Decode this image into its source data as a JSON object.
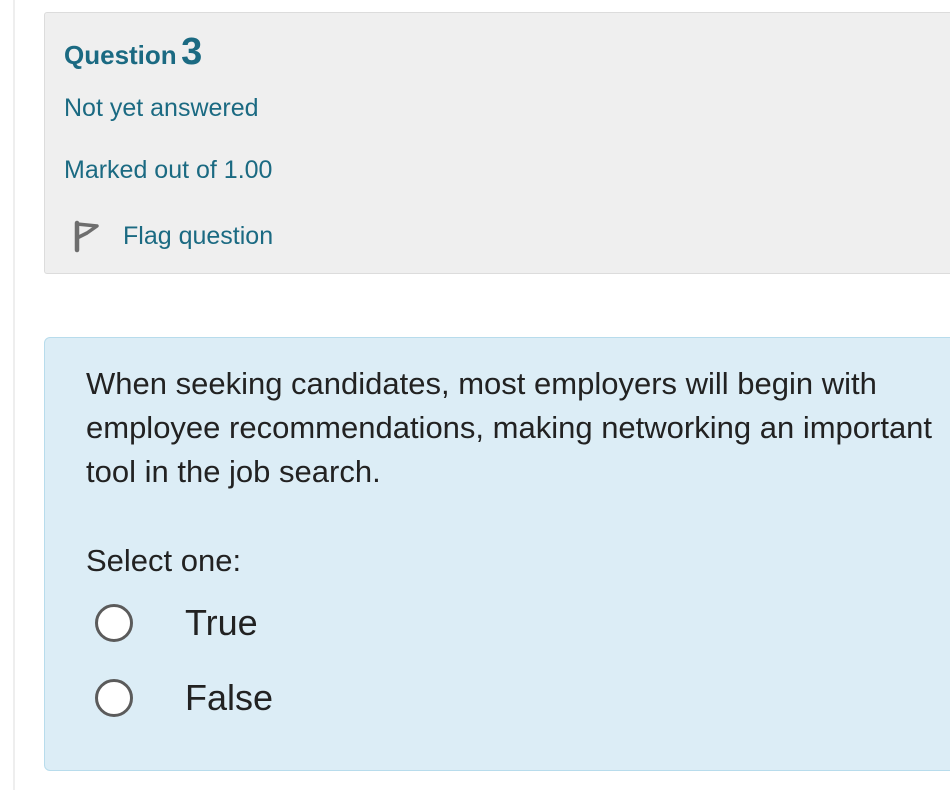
{
  "question_info": {
    "question_word": "Question",
    "question_number": "3",
    "state": "Not yet answered",
    "grade": "Marked out of 1.00",
    "flag_label": "Flag question",
    "flag_icon": "flag-icon"
  },
  "question": {
    "text": "When seeking candidates, most employers will begin with employee recommendations, making networking an important tool in the job search.",
    "prompt": "Select one:",
    "options": [
      {
        "label": "True",
        "selected": false
      },
      {
        "label": "False",
        "selected": false
      }
    ]
  },
  "colors": {
    "accent": "#1b6a82",
    "info_background": "#efefef",
    "content_background": "#dcedf6",
    "content_border": "#b8dcec"
  }
}
